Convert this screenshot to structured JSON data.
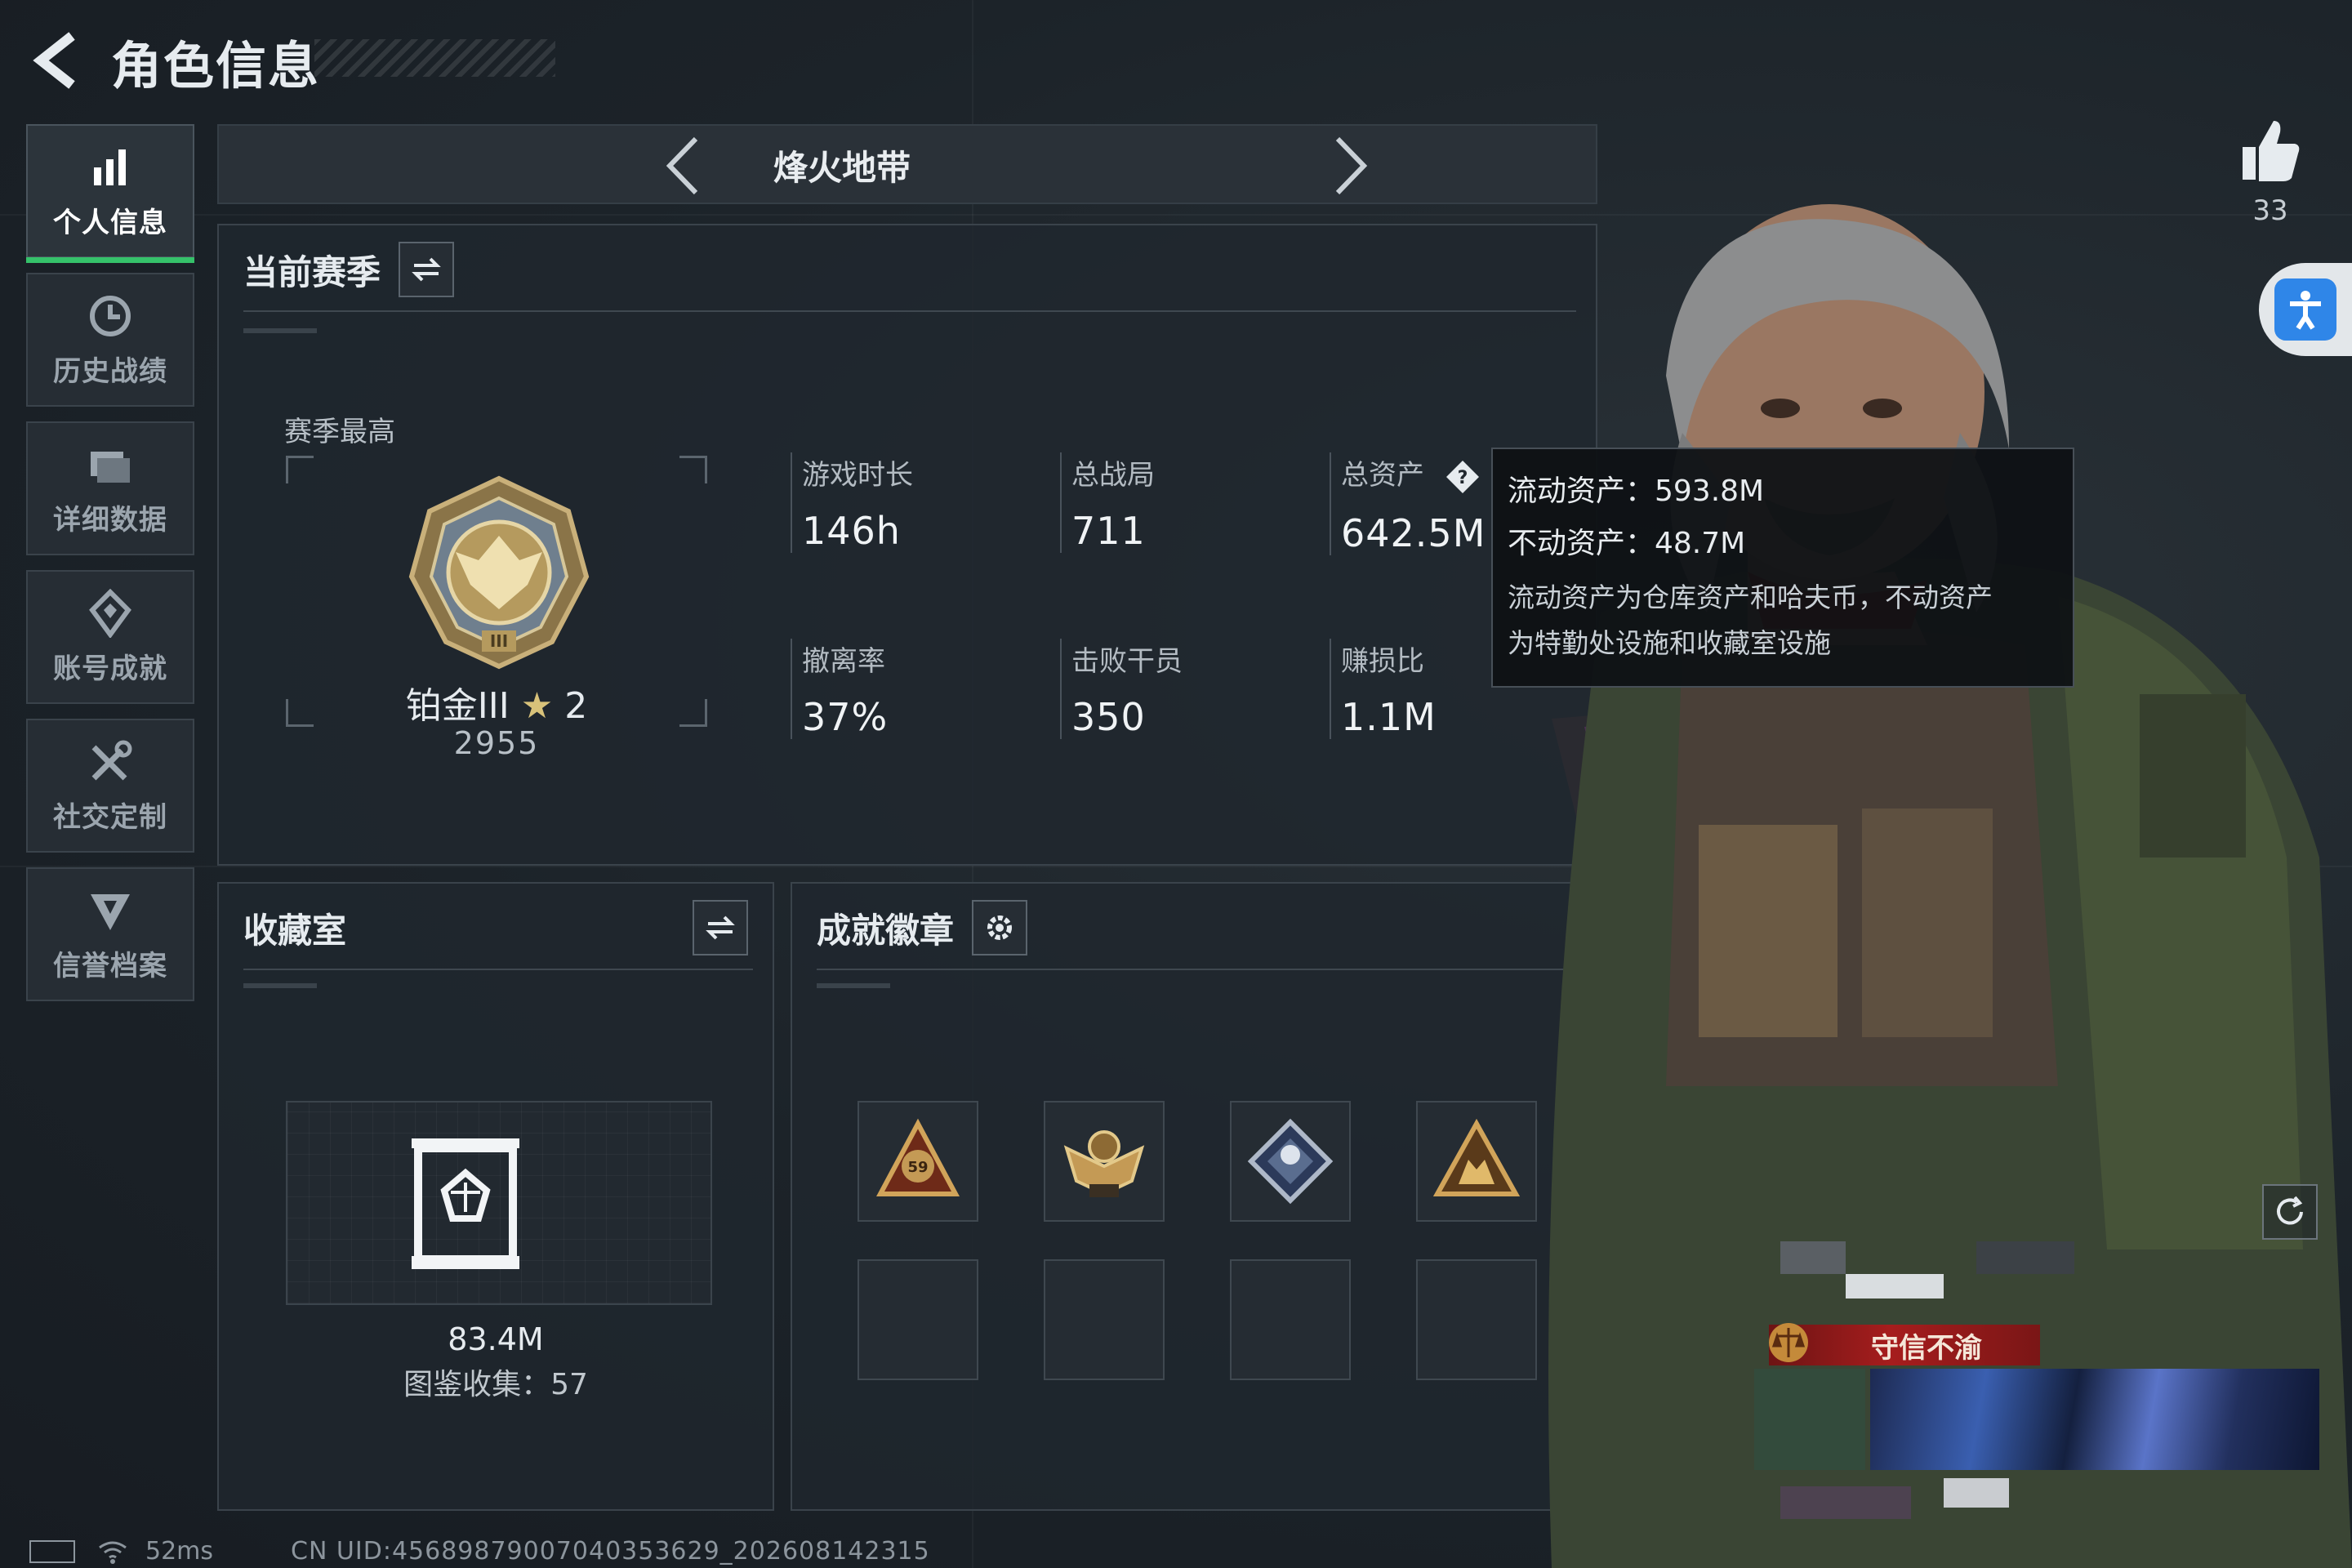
{
  "header": {
    "title": "角色信息"
  },
  "sidebar": {
    "items": [
      {
        "label": "个人信息",
        "icon": "bar-chart-icon",
        "active": true
      },
      {
        "label": "历史战绩",
        "icon": "history-clock-icon",
        "active": false
      },
      {
        "label": "详细数据",
        "icon": "folder-icon",
        "active": false
      },
      {
        "label": "账号成就",
        "icon": "achievement-icon",
        "active": false
      },
      {
        "label": "社交定制",
        "icon": "tools-icon",
        "active": false
      },
      {
        "label": "信誉档案",
        "icon": "credit-shield-icon",
        "active": false
      }
    ]
  },
  "mode": {
    "title": "烽火地带"
  },
  "season": {
    "title": "当前赛季",
    "best_label": "赛季最高",
    "rank_name": "铂金III",
    "rank_stars": "2",
    "rank_score": "2955",
    "stats": {
      "play_time": {
        "label": "游戏时长",
        "value": "146h"
      },
      "total_matches": {
        "label": "总战局",
        "value": "711"
      },
      "total_assets": {
        "label": "总资产",
        "value": "642.5M"
      },
      "extract_rate": {
        "label": "撤离率",
        "value": "37%"
      },
      "kills": {
        "label": "击败干员",
        "value": "350"
      },
      "profit_ratio": {
        "label": "赚损比",
        "value": "1.1M"
      }
    }
  },
  "tooltip": {
    "liquid": "流动资产：593.8M",
    "fixed": "不动资产：48.7M",
    "desc_line1": "流动资产为仓库资产和哈夫币，不动资产",
    "desc_line2": "为特勤处设施和收藏室设施"
  },
  "collection": {
    "title": "收藏室",
    "value": "83.4M",
    "count": "图鉴收集：57"
  },
  "achievements": {
    "title": "成就徽章",
    "badges": [
      "badge-59-icon",
      "badge-eagle-icon",
      "badge-diamond-icon",
      "badge-beast-icon"
    ]
  },
  "social": {
    "likes": "33",
    "honor_title": "守信不渝"
  },
  "status_bar": {
    "ping": "52ms",
    "uid": "CN UID:4568987900704035362​9_202608142315"
  },
  "colors": {
    "accent_green": "#35c26a",
    "honor_red": "#a61d1d",
    "access_blue": "#2f86e8"
  }
}
